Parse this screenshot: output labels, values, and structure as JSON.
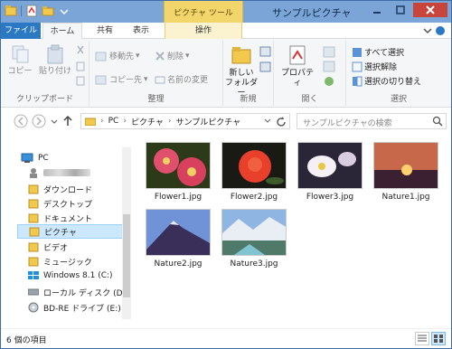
{
  "window": {
    "title": "サンプルピクチャ"
  },
  "context_tab_header": "ピクチャ ツール",
  "ribbon_tabs": [
    "ファイル",
    "ホーム",
    "共有",
    "表示",
    "操作"
  ],
  "ribbon": {
    "clipboard": {
      "label": "クリップボード",
      "copy": "コピー",
      "paste": "貼り付け"
    },
    "organize": {
      "label": "整理",
      "move_to": "移動先",
      "copy_to": "コピー先",
      "delete": "削除",
      "rename": "名前の変更"
    },
    "new": {
      "label": "新規",
      "new_folder": "新しい フォルダー"
    },
    "open": {
      "label": "開く",
      "properties": "プロパティ"
    },
    "select": {
      "label": "選択",
      "select_all": "すべて選択",
      "select_none": "選択解除",
      "invert": "選択の切り替え"
    }
  },
  "address": {
    "crumbs": [
      "PC",
      "ピクチャ",
      "サンプルピクチャ"
    ],
    "search_placeholder": "サンプルピクチャの検索"
  },
  "nav": [
    {
      "label": "PC",
      "icon": "pc-icon"
    },
    {
      "label": "",
      "icon": "user-icon",
      "blurred": true
    },
    {
      "label": "ダウンロード",
      "icon": "folder-icon"
    },
    {
      "label": "デスクトップ",
      "icon": "folder-icon"
    },
    {
      "label": "ドキュメント",
      "icon": "folder-icon"
    },
    {
      "label": "ピクチャ",
      "icon": "folder-icon",
      "selected": true
    },
    {
      "label": "ビデオ",
      "icon": "folder-icon"
    },
    {
      "label": "ミュージック",
      "icon": "folder-icon"
    },
    {
      "label": "Windows 8.1 (C:)",
      "icon": "drive-icon"
    },
    {
      "label": "ローカル ディスク (D:)",
      "icon": "drive-icon"
    },
    {
      "label": "BD-RE ドライブ (E:)",
      "icon": "disc-drive-icon"
    }
  ],
  "files": [
    {
      "name": "Flower1.jpg"
    },
    {
      "name": "Flower2.jpg"
    },
    {
      "name": "Flower3.jpg"
    },
    {
      "name": "Nature1.jpg"
    },
    {
      "name": "Nature2.jpg"
    },
    {
      "name": "Nature3.jpg"
    }
  ],
  "status": {
    "count_text": "6 個の項目"
  },
  "colors": {
    "accent": "#2b78c3",
    "context_tab": "#f3d66b",
    "titlebar": "#7aa5d6",
    "selection": "#cce8ff"
  }
}
